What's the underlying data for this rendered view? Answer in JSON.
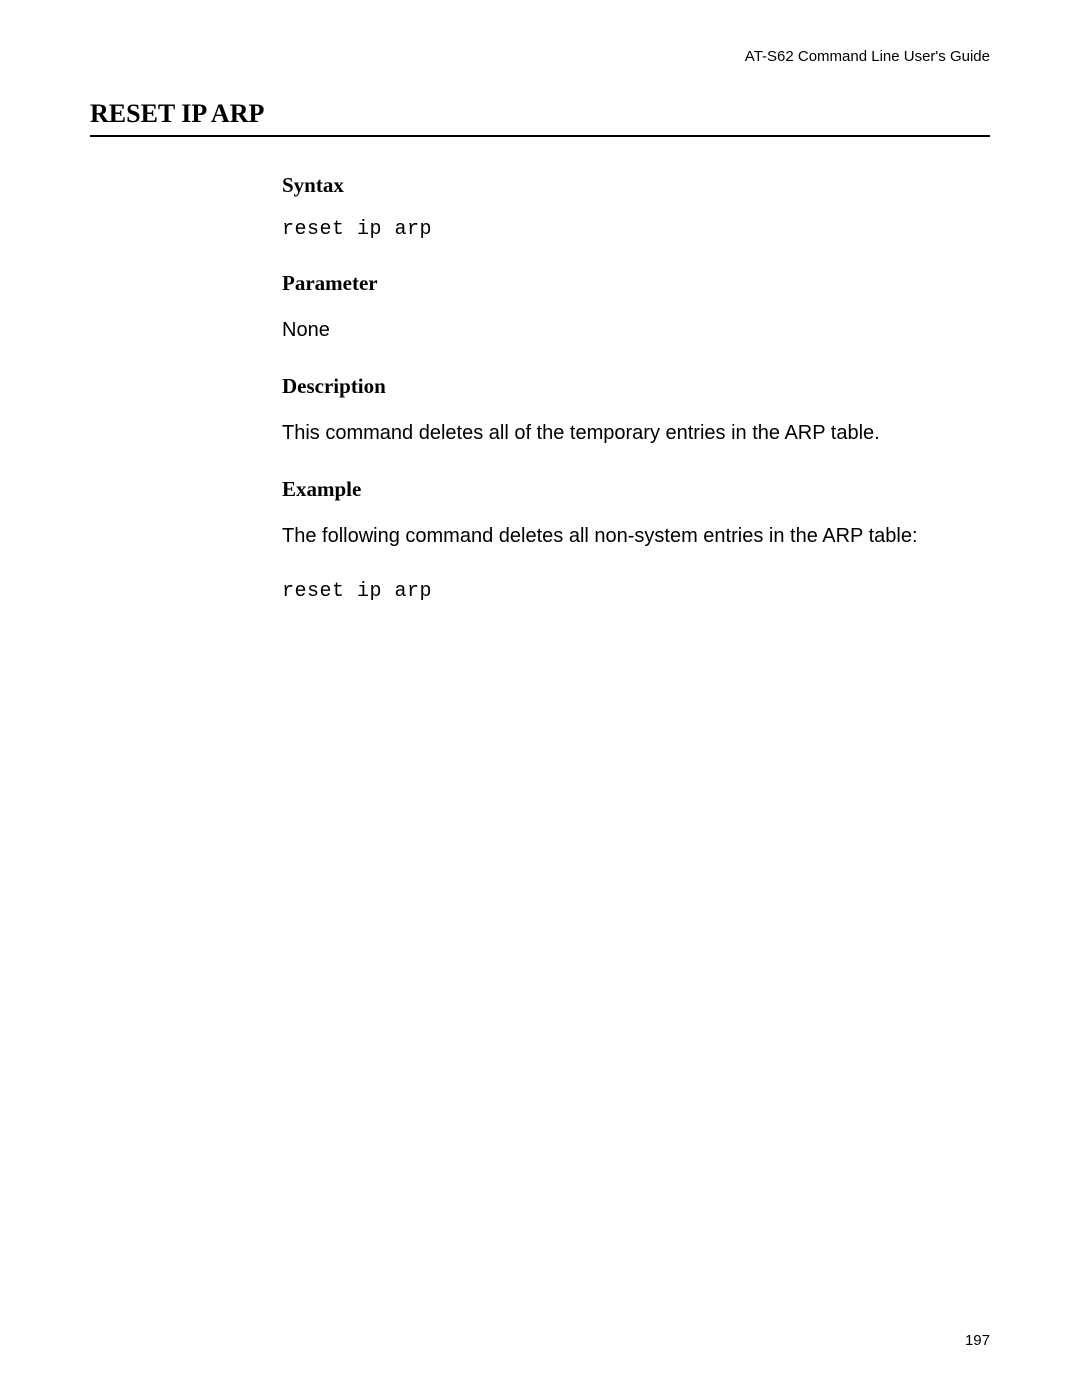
{
  "header": {
    "guide_title": "AT-S62 Command Line User's Guide"
  },
  "main_title": "RESET IP ARP",
  "sections": {
    "syntax": {
      "heading": "Syntax",
      "code": "reset ip arp"
    },
    "parameter": {
      "heading": "Parameter",
      "text": "None"
    },
    "description": {
      "heading": "Description",
      "text": "This command deletes all of the temporary entries in the ARP table."
    },
    "example": {
      "heading": "Example",
      "text": "The following command deletes all non-system entries in the ARP table:",
      "code": "reset ip arp"
    }
  },
  "page_number": "197"
}
